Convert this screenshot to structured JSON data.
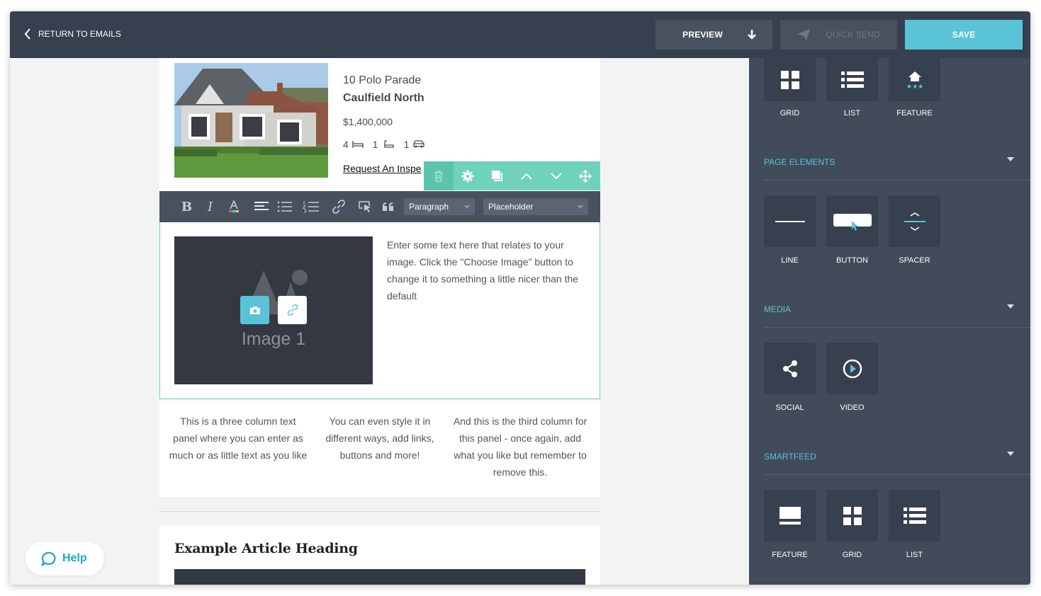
{
  "topbar": {
    "back_label": "RETURN TO EMAILS",
    "preview_label": "PREVIEW",
    "quick_send_label": "QUICK SEND",
    "save_label": "SAVE"
  },
  "property": {
    "street": "10 Polo Parade",
    "suburb": "Caulfield North",
    "price": "$1,400,000",
    "beds": "4",
    "baths": "1",
    "cars": "1",
    "link_text": "Request An Inspe"
  },
  "editor_toolbar": {
    "format_select": "Paragraph",
    "placeholder_select": "Placeholder"
  },
  "image_block": {
    "image_label": "Image 1",
    "text": "Enter some text here that relates to your image. Click the \"Choose Image\" button to change it to something a little nicer than the default"
  },
  "columns": [
    "This is a three column text panel where you can enter as much or as little text as you like",
    "You can even style it in different ways, add links, buttons and more!",
    "And this is the third column for this panel - once again, add what you like but remember to remove this."
  ],
  "article": {
    "heading": "Example Article Heading"
  },
  "help": {
    "label": "Help"
  },
  "sidebar": {
    "top_tiles": [
      "GRID",
      "LIST",
      "FEATURE"
    ],
    "sections": [
      {
        "title": "PAGE ELEMENTS",
        "items": [
          "LINE",
          "BUTTON",
          "SPACER"
        ]
      },
      {
        "title": "MEDIA",
        "items": [
          "SOCIAL",
          "VIDEO"
        ]
      },
      {
        "title": "SMARTFEED",
        "items": [
          "FEATURE",
          "GRID",
          "LIST"
        ]
      }
    ]
  },
  "colors": {
    "topbar": "#36404e",
    "accent": "#5ac3d7",
    "block_tools": "#6fd2bb",
    "sidebar": "#414b59"
  }
}
